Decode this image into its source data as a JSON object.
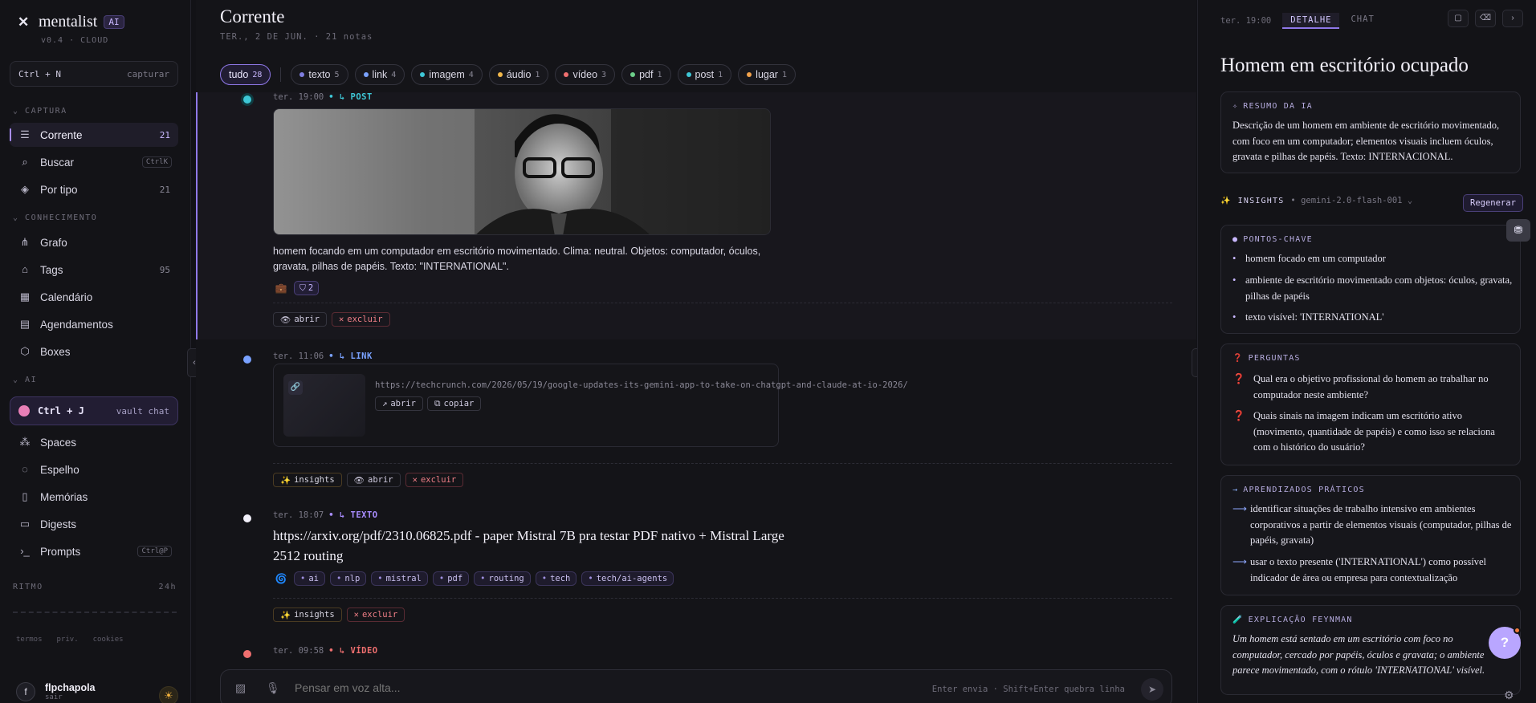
{
  "app": {
    "name": "mentalist",
    "badge": "AI",
    "version": "v0.4 · CLOUD"
  },
  "capture": {
    "keys": "Ctrl + N",
    "label": "capturar"
  },
  "sidebar": {
    "section_captura": "CAPTURA",
    "section_conhecimento": "CONHECIMENTO",
    "section_ai": "AI",
    "items": [
      {
        "label": "Corrente",
        "count": "21",
        "icon": "stream-icon"
      },
      {
        "label": "Buscar",
        "kbd": "CtrlK",
        "icon": "search-icon"
      },
      {
        "label": "Por tipo",
        "count": "21",
        "icon": "layers-icon"
      },
      {
        "label": "Grafo",
        "icon": "graph-icon"
      },
      {
        "label": "Tags",
        "count": "95",
        "icon": "tag-icon"
      },
      {
        "label": "Calendário",
        "icon": "calendar-icon"
      },
      {
        "label": "Agendamentos",
        "icon": "schedule-icon"
      },
      {
        "label": "Boxes",
        "icon": "box-icon"
      },
      {
        "label": "Spaces",
        "icon": "spaces-icon"
      },
      {
        "label": "Espelho",
        "icon": "mirror-icon"
      },
      {
        "label": "Memórias",
        "icon": "bookmark-icon"
      },
      {
        "label": "Digests",
        "icon": "digest-icon"
      },
      {
        "label": "Prompts",
        "kbd": "Ctrl@P",
        "icon": "prompt-icon"
      }
    ],
    "vault": {
      "keys": "Ctrl + J",
      "label": "vault chat"
    },
    "ritmo": {
      "label": "RITMO",
      "range": "24h"
    },
    "legal": [
      "termos",
      "priv.",
      "cookies"
    ],
    "user": {
      "initial": "f",
      "name": "flpchapola",
      "action": "sair"
    }
  },
  "main": {
    "title": "Corrente",
    "subtitle": "TER., 2 DE JUN. · 21 notas",
    "filters": [
      {
        "label": "tudo",
        "count": "28",
        "color": ""
      },
      {
        "label": "texto",
        "count": "5",
        "color": "#7f7ee0"
      },
      {
        "label": "link",
        "count": "4",
        "color": "#7aa2ff"
      },
      {
        "label": "imagem",
        "count": "4",
        "color": "#3ec7d6"
      },
      {
        "label": "áudio",
        "count": "1",
        "color": "#f2b84b"
      },
      {
        "label": "vídeo",
        "count": "3",
        "color": "#ef6f6f"
      },
      {
        "label": "pdf",
        "count": "1",
        "color": "#6ccf8a"
      },
      {
        "label": "post",
        "count": "1",
        "color": "#3ec7d6"
      },
      {
        "label": "lugar",
        "count": "1",
        "color": "#f2a24b"
      }
    ],
    "entries": {
      "post": {
        "time": "ter. 19:00",
        "kind": "POST",
        "color": "#3ec7d6",
        "desc": "homem focando em um computador em escritório movimentado. Clima: neutral. Objetos: computador, óculos, gravata, pilhas de papéis. Texto: \"INTERNATIONAL\".",
        "badge": "2",
        "actions": [
          "abrir",
          "excluir"
        ]
      },
      "link": {
        "time": "ter. 11:06",
        "kind": "LINK",
        "color": "#7aa2ff",
        "url": "https://techcrunch.com/2026/05/19/google-updates-its-gemini-app-to-take-on-chatgpt-and-claude-at-io-2026/",
        "mini": [
          "abrir",
          "copiar"
        ],
        "actions": [
          "insights",
          "abrir",
          "excluir"
        ]
      },
      "texto": {
        "time": "ter. 18:07",
        "kind": "TEXTO",
        "color": "#a98dff",
        "title": "https://arxiv.org/pdf/2310.06825.pdf - paper Mistral 7B pra testar PDF nativo + Mistral Large 2512 routing",
        "tags": [
          "ai",
          "nlp",
          "mistral",
          "pdf",
          "routing",
          "tech",
          "tech/ai-agents"
        ],
        "actions": [
          "insights",
          "excluir"
        ]
      },
      "video": {
        "time": "ter. 09:58",
        "kind": "VÍDEO",
        "color": "#ef6f6f"
      }
    },
    "composer": {
      "placeholder": "Pensar em voz alta...",
      "hint": "Enter envia · Shift+Enter quebra linha"
    }
  },
  "panel": {
    "time": "ter. 19:00",
    "tabs": [
      "DETALHE",
      "CHAT"
    ],
    "title": "Homem em escritório ocupado",
    "summary": {
      "heading": "RESUMO DA IA",
      "text": "Descrição de um homem em ambiente de escritório movimentado, com foco em um computador; elementos visuais incluem óculos, gravata e pilhas de papéis. Texto: INTERNACIONAL."
    },
    "insights": {
      "heading": "INSIGHTS",
      "model": "gemini-2.0-flash-001",
      "button": "Regenerar"
    },
    "key_points": {
      "heading": "PONTOS-CHAVE",
      "items": [
        "homem focado em um computador",
        "ambiente de escritório movimentado com objetos: óculos, gravata, pilhas de papéis",
        "texto visível: 'INTERNATIONAL'"
      ]
    },
    "questions": {
      "heading": "PERGUNTAS",
      "items": [
        "Qual era o objetivo profissional do homem ao trabalhar no computador neste ambiente?",
        "Quais sinais na imagem indicam um escritório ativo (movimento, quantidade de papéis) e como isso se relaciona com o histórico do usuário?"
      ]
    },
    "learnings": {
      "heading": "APRENDIZADOS PRÁTICOS",
      "items": [
        "identificar situações de trabalho intensivo em ambientes corporativos a partir de elementos visuais (computador, pilhas de papéis, gravata)",
        "usar o texto presente ('INTERNATIONAL') como possível indicador de área ou empresa para contextualização"
      ]
    },
    "feynman": {
      "heading": "EXPLICAÇÃO FEYNMAN",
      "text": "Um homem está sentado em um escritório com foco no computador, cercado por papéis, óculos e gravata; o ambiente parece movimentado, com o rótulo 'INTERNATIONAL' visível."
    }
  }
}
